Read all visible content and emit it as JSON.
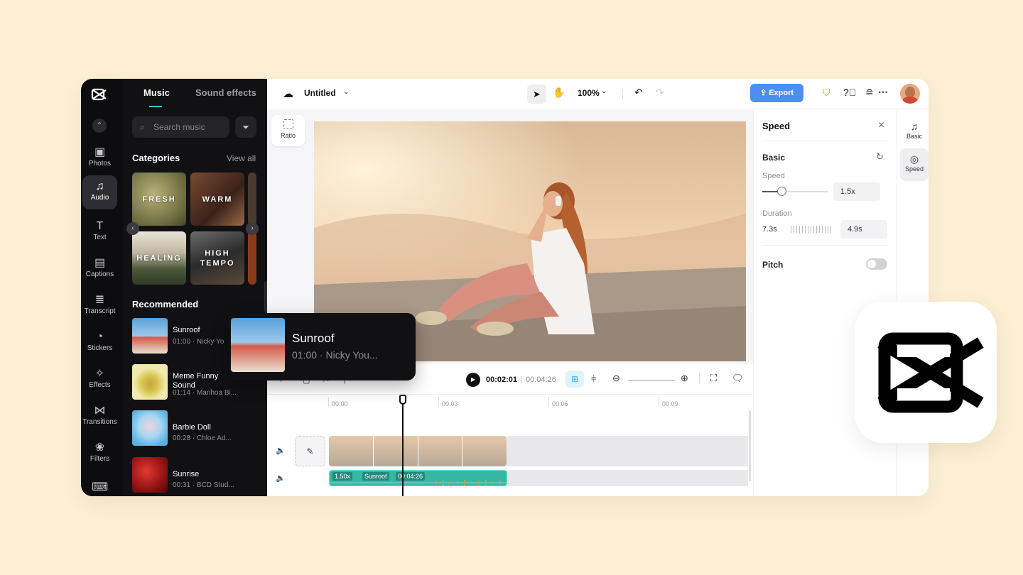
{
  "rail": {
    "items": [
      {
        "label": "Photos",
        "icon": "photos-icon"
      },
      {
        "label": "Audio",
        "icon": "audio-icon"
      },
      {
        "label": "Text",
        "icon": "text-icon"
      },
      {
        "label": "Captions",
        "icon": "captions-icon"
      },
      {
        "label": "Transcript",
        "icon": "transcript-icon"
      },
      {
        "label": "Stickers",
        "icon": "stickers-icon"
      },
      {
        "label": "Effects",
        "icon": "effects-icon"
      },
      {
        "label": "Transitions",
        "icon": "transitions-icon"
      },
      {
        "label": "Filters",
        "icon": "filters-icon"
      }
    ]
  },
  "panel": {
    "tabs": [
      "Music",
      "Sound effects"
    ],
    "search_placeholder": "Search music",
    "categories_title": "Categories",
    "view_all": "View all",
    "categories": [
      "FRESH",
      "WARM",
      "HEALING",
      "HIGH TEMPO"
    ],
    "recommended_title": "Recommended",
    "songs": [
      {
        "name": "Sunroof",
        "meta": "01:00 · Nicky Yo"
      },
      {
        "name": "Meme Funny Sound",
        "meta": "01:14 · Manhoa Bi..."
      },
      {
        "name": "Barbie Doll",
        "meta": "00:28 · Chloe Ad..."
      },
      {
        "name": "Sunrise",
        "meta": "00:31 · BCD Stud..."
      }
    ]
  },
  "topbar": {
    "project_name": "Untitled",
    "zoom": "100%",
    "export_label": "Export"
  },
  "canvas": {
    "ratio_label": "Ratio"
  },
  "player": {
    "current_time": "00:02:01",
    "total_time": "00:04:26"
  },
  "timeline": {
    "ruler": [
      "00:00",
      "00:03",
      "00:06",
      "00:09"
    ],
    "audio_clip": {
      "speed": "1.50x",
      "name": "Sunroof",
      "duration": "00:04:26"
    }
  },
  "speed_panel": {
    "title": "Speed",
    "section": "Basic",
    "speed_label": "Speed",
    "speed_value": "1.5x",
    "duration_label": "Duration",
    "duration_original": "7.3s",
    "duration_value": "4.9s",
    "pitch_label": "Pitch",
    "pitch_enabled": false
  },
  "right_rail": {
    "items": [
      "Basic",
      "Speed"
    ]
  },
  "popup": {
    "name": "Sunroof",
    "meta": "01:00 · Nicky You..."
  },
  "colors": {
    "accent": "#38c7e0",
    "export": "#4f8df5",
    "audio_clip": "#35b7a4",
    "background": "#fdefd3"
  }
}
